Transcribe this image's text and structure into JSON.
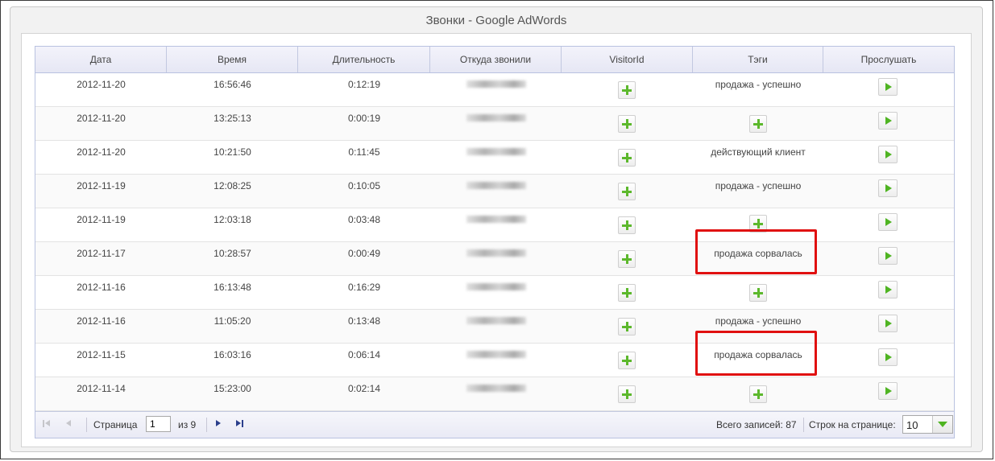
{
  "window": {
    "title": "Звонки - Google AdWords"
  },
  "columns": [
    "Дата",
    "Время",
    "Длительность",
    "Откуда звонили",
    "VisitorId",
    "Тэги",
    "Прослушать"
  ],
  "rows": [
    {
      "date": "2012-11-20",
      "time": "16:56:46",
      "duration": "0:12:19",
      "tag": "продажа - успешно",
      "tag_empty": false,
      "highlighted": false
    },
    {
      "date": "2012-11-20",
      "time": "13:25:13",
      "duration": "0:00:19",
      "tag": "",
      "tag_empty": true,
      "highlighted": false
    },
    {
      "date": "2012-11-20",
      "time": "10:21:50",
      "duration": "0:11:45",
      "tag": "действующий клиент",
      "tag_empty": false,
      "highlighted": false
    },
    {
      "date": "2012-11-19",
      "time": "12:08:25",
      "duration": "0:10:05",
      "tag": "продажа - успешно",
      "tag_empty": false,
      "highlighted": false
    },
    {
      "date": "2012-11-19",
      "time": "12:03:18",
      "duration": "0:03:48",
      "tag": "",
      "tag_empty": true,
      "highlighted": false
    },
    {
      "date": "2012-11-17",
      "time": "10:28:57",
      "duration": "0:00:49",
      "tag": "продажа сорвалась",
      "tag_empty": false,
      "highlighted": true
    },
    {
      "date": "2012-11-16",
      "time": "16:13:48",
      "duration": "0:16:29",
      "tag": "",
      "tag_empty": true,
      "highlighted": false
    },
    {
      "date": "2012-11-16",
      "time": "11:05:20",
      "duration": "0:13:48",
      "tag": "продажа - успешно",
      "tag_empty": false,
      "highlighted": false
    },
    {
      "date": "2012-11-15",
      "time": "16:03:16",
      "duration": "0:06:14",
      "tag": "продажа сорвалась",
      "tag_empty": false,
      "highlighted": true
    },
    {
      "date": "2012-11-14",
      "time": "15:23:00",
      "duration": "0:02:14",
      "tag": "",
      "tag_empty": true,
      "highlighted": false
    }
  ],
  "pager": {
    "page_label": "Страница",
    "current_page": "1",
    "of_label": "из 9",
    "total_label": "Всего записей: 87",
    "rows_per_page_label": "Строк на странице:",
    "rows_per_page": "10"
  },
  "icons": {
    "add": "plus-icon",
    "play": "play-icon",
    "first": "first-page-icon",
    "prev": "prev-page-icon",
    "next": "next-page-icon",
    "last": "last-page-icon",
    "dropdown": "chevron-down-icon"
  },
  "colors": {
    "accent_green": "#5cb82c",
    "highlight_red": "#e01010",
    "header_border": "#b9c2e0"
  }
}
